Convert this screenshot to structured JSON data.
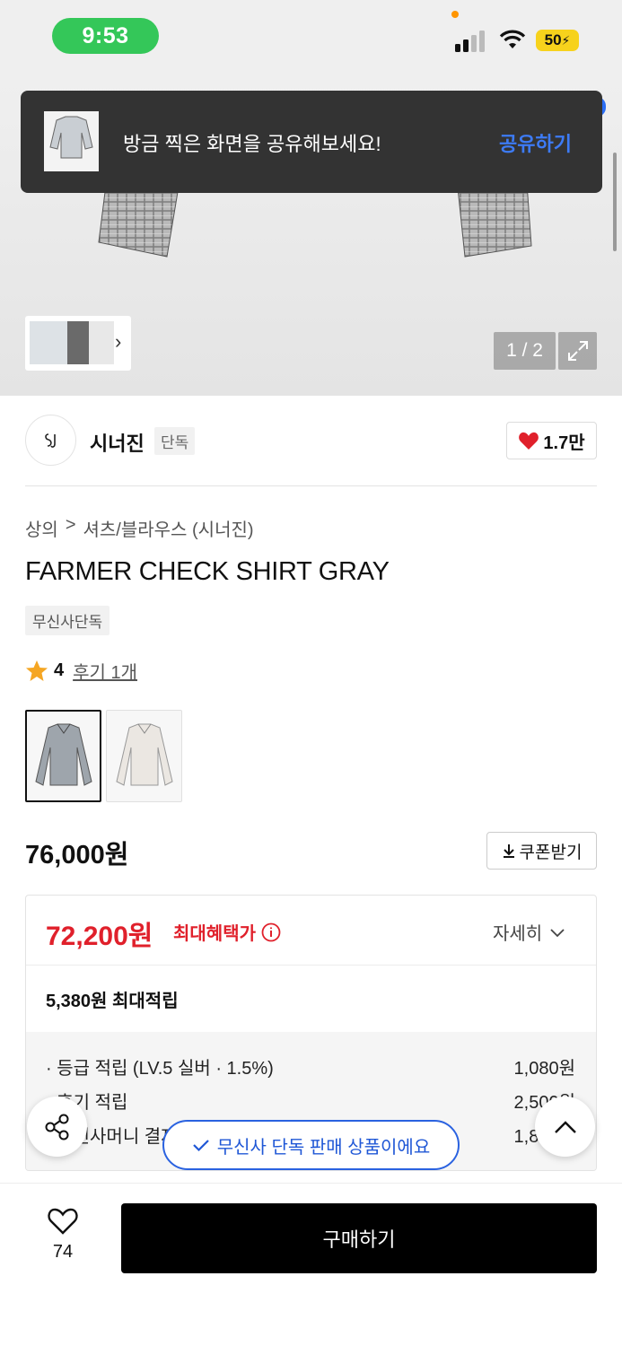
{
  "status_bar": {
    "time": "9:53",
    "battery": "50"
  },
  "toast": {
    "message": "방금 찍은 화면을 공유해보세요!",
    "action": "공유하기"
  },
  "gallery": {
    "page_counter": "1 / 2"
  },
  "brand": {
    "name": "시너진",
    "badge": "단독",
    "likes": "1.7만"
  },
  "breadcrumb": [
    "상의",
    "셔츠/블라우스 (시너진)"
  ],
  "product": {
    "title": "FARMER CHECK SHIRT GRAY",
    "tag": "무신사단독",
    "rating": "4",
    "review_link": "후기 1개",
    "options": [
      "gray",
      "white"
    ]
  },
  "price": {
    "original": "76,000원",
    "coupon_label": "쿠폰받기",
    "sale": "72,200원",
    "sale_label": "최대혜택가",
    "detail_label": "자세히",
    "point_total": "5,380원 최대적립",
    "points": [
      {
        "label": "· 등급 적립 (LV.5 실버 · 1.5%)",
        "value": "1,080원"
      },
      {
        "label": "· 후기 적립",
        "value": "2,500원"
      },
      {
        "label": "· 무신사머니 결제 적립",
        "value": "1,800원"
      }
    ]
  },
  "floating": {
    "exclusive_notice": "무신사 단독 판매 상품이에요"
  },
  "bottom": {
    "wish_count": "74",
    "buy_label": "구매하기"
  },
  "colors": {
    "sale_red": "#e0202b",
    "accent_blue": "#2a62e0",
    "status_green": "#34c759"
  }
}
